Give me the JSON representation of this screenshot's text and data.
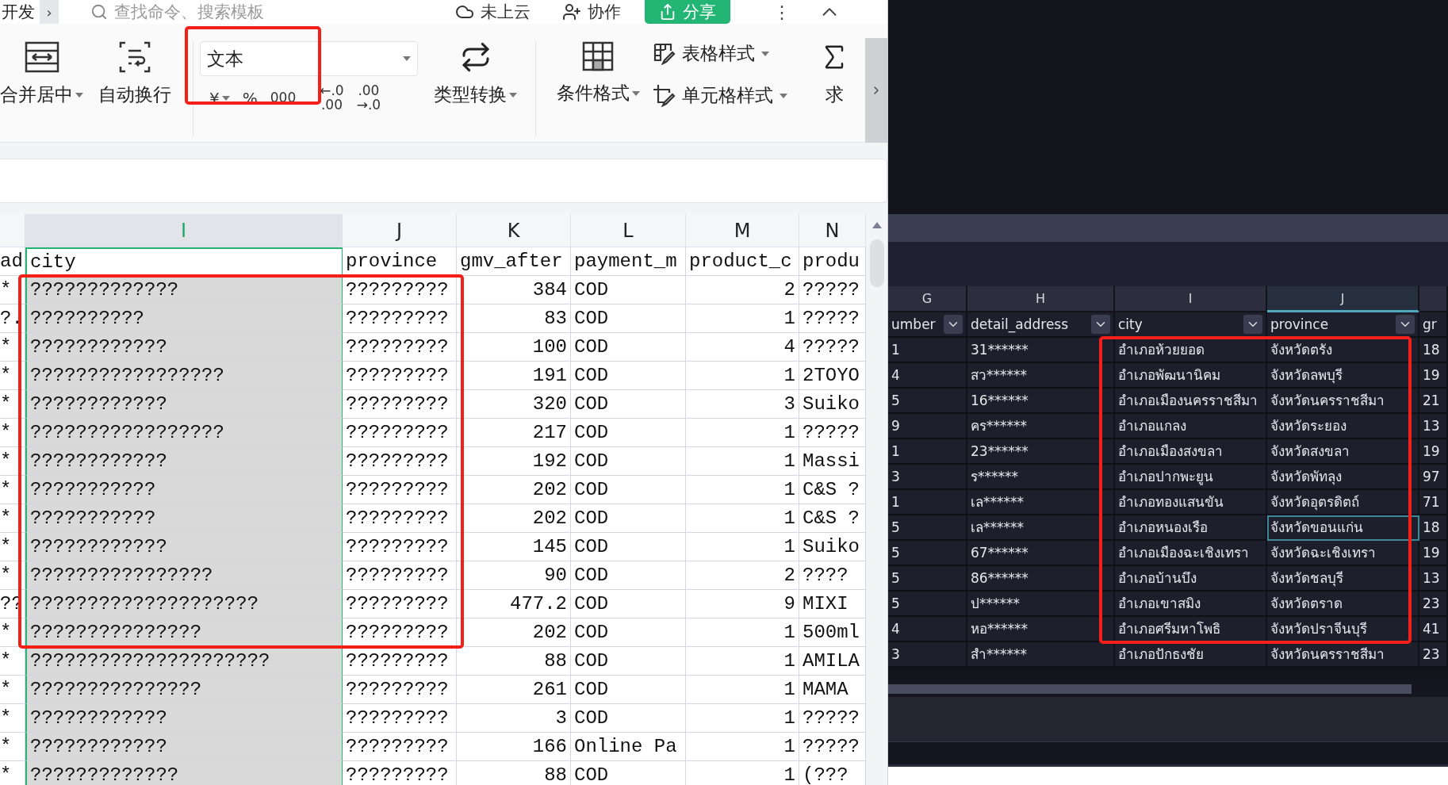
{
  "left": {
    "top_bar": {
      "menu_tab": "开发",
      "more": "›",
      "search": {
        "placeholder": "查找命令、搜索模板"
      },
      "cloud_status": "未上云",
      "collaborate": "协作",
      "share": "分享",
      "more_menu": "⋮"
    },
    "ribbon": {
      "merge": "合并居中",
      "wrap": "自动换行",
      "number_format": {
        "value": "文本"
      },
      "format_buttons": [
        {
          "kind": "currency",
          "label": "¥"
        },
        {
          "kind": "percent",
          "label": "%"
        },
        {
          "kind": "thousands",
          "label": "000"
        },
        {
          "kind": "decimal",
          "top": "←.0",
          "bottom": ".00"
        },
        {
          "kind": "decimal",
          "top": ".00",
          "bottom": "→.0"
        }
      ],
      "convert": "类型转换",
      "conditional": "条件格式",
      "table_style": "表格样式",
      "cell_style": "单元格样式",
      "sum": "求"
    },
    "sheet": {
      "columns": [
        {
          "selected": false
        },
        {
          "letter": "I",
          "selected": true
        },
        {
          "letter": "J",
          "selected": false
        },
        {
          "letter": "K",
          "selected": false
        },
        {
          "letter": "L",
          "selected": false
        },
        {
          "letter": "M",
          "selected": false
        },
        {
          "letter": "N",
          "selected": false
        }
      ],
      "header": [
        "ad",
        "city",
        "province",
        "gmv_after",
        "payment_m",
        "product_c",
        "produ"
      ],
      "rows": [
        [
          "*",
          "?????????????",
          "?????????",
          "384",
          "COD",
          "2",
          "?????"
        ],
        [
          "?.",
          "??????????",
          "?????????",
          "83",
          "COD",
          "1",
          "?????"
        ],
        [
          "*",
          "????????????",
          "?????????",
          "100",
          "COD",
          "4",
          "?????"
        ],
        [
          "*",
          "?????????????????",
          "?????????",
          "191",
          "COD",
          "1",
          "2TOYO"
        ],
        [
          "*",
          "????????????",
          "?????????",
          "320",
          "COD",
          "3",
          "Suiko"
        ],
        [
          "*",
          "?????????????????",
          "?????????",
          "217",
          "COD",
          "1",
          "?????"
        ],
        [
          "*",
          "????????????",
          "?????????",
          "192",
          "COD",
          "1",
          "Massi"
        ],
        [
          "*",
          "???????????",
          "?????????",
          "202",
          "COD",
          "1",
          "C&S ?"
        ],
        [
          "*",
          "???????????",
          "?????????",
          "202",
          "COD",
          "1",
          "C&S ?"
        ],
        [
          "*",
          "????????????",
          "?????????",
          "145",
          "COD",
          "1",
          "Suiko"
        ],
        [
          "*",
          "????????????????",
          "?????????",
          "90",
          "COD",
          "2",
          "????"
        ],
        [
          "??",
          "????????????????????",
          "?????????",
          "477.2",
          "COD",
          "9",
          "MIXI"
        ],
        [
          "*",
          "???????????????",
          "?????????",
          "202",
          "COD",
          "1",
          "500ml"
        ],
        [
          "*",
          "?????????????????????",
          "?????????",
          "88",
          "COD",
          "1",
          "AMILA"
        ],
        [
          "*",
          "???????????????",
          "?????????",
          "261",
          "COD",
          "1",
          "MAMA"
        ],
        [
          "*",
          "????????????",
          "?????????",
          "3",
          "COD",
          "1",
          "?????"
        ],
        [
          "*",
          "????????????",
          "?????????",
          "166",
          "Online Pa",
          "1",
          "?????"
        ],
        [
          "*",
          "?????????????",
          "?????????",
          "88",
          "COD",
          "1",
          "(???"
        ]
      ]
    }
  },
  "right": {
    "columns": [
      {
        "letter": "G",
        "selected": false
      },
      {
        "letter": "H",
        "selected": false
      },
      {
        "letter": "I",
        "selected": false
      },
      {
        "letter": "J",
        "selected": true
      },
      {
        "selected": false
      }
    ],
    "header": [
      "umber",
      "detail_address",
      "city",
      "province",
      "gr"
    ],
    "rows": [
      {
        "selected": false,
        "cells": [
          "1",
          "31******",
          "อำเภอห้วยยอด",
          "จังหวัดตรัง",
          "18"
        ]
      },
      {
        "selected": false,
        "cells": [
          "4",
          "สว******",
          "อำเภอพัฒนานิคม",
          "จังหวัดลพบุรี",
          "19"
        ]
      },
      {
        "selected": false,
        "cells": [
          "5",
          "16******",
          "อำเภอเมืองนครราชสีมา",
          "จังหวัดนครราชสีมา",
          "21"
        ]
      },
      {
        "selected": false,
        "cells": [
          "9",
          "คร******",
          "อำเภอแกลง",
          "จังหวัดระยอง",
          "13"
        ]
      },
      {
        "selected": false,
        "cells": [
          "1",
          "23******",
          "อำเภอเมืองสงขลา",
          "จังหวัดสงขลา",
          "19"
        ]
      },
      {
        "selected": false,
        "cells": [
          "3",
          "ร******",
          "อำเภอปากพะยูน",
          "จังหวัดพัทลุง",
          "97"
        ]
      },
      {
        "selected": false,
        "cells": [
          "1",
          "เล******",
          "อำเภอทองแสนขัน",
          "จังหวัดอุตรดิตถ์",
          "71"
        ]
      },
      {
        "selected": true,
        "cells": [
          "5",
          "เล******",
          "อำเภอหนองเรือ",
          "จังหวัดขอนแก่น",
          "18"
        ]
      },
      {
        "selected": false,
        "cells": [
          "5",
          "67******",
          "อำเภอเมืองฉะเชิงเทรา",
          "จังหวัดฉะเชิงเทรา",
          "19"
        ]
      },
      {
        "selected": false,
        "cells": [
          "5",
          "86******",
          "อำเภอบ้านบึง",
          "จังหวัดชลบุรี",
          "13"
        ]
      },
      {
        "selected": false,
        "cells": [
          "5",
          "ป******",
          "อำเภอเขาสมิง",
          "จังหวัดตราด",
          "23"
        ]
      },
      {
        "selected": false,
        "cells": [
          "4",
          "หอ******",
          "อำเภอศรีมหาโพธิ",
          "จังหวัดปราจีนบุรี",
          "41"
        ]
      },
      {
        "selected": false,
        "cells": [
          "3",
          "สำ******",
          "อำเภอปักธงชัย",
          "จังหวัดนครราชสีมา",
          "23"
        ]
      }
    ]
  }
}
